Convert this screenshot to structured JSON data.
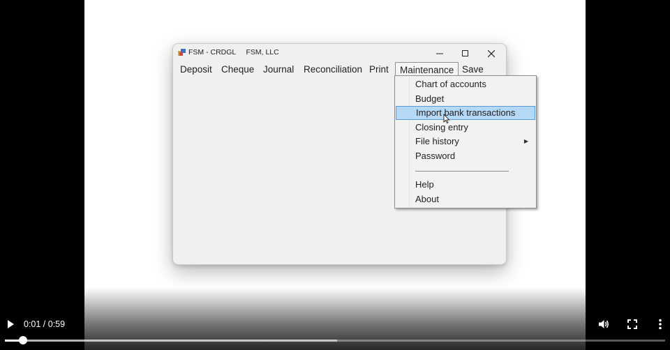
{
  "app": {
    "title": "FSM - CRDGL",
    "company": "FSM, LLC",
    "window_controls": {
      "minimize_icon": "minimize-icon",
      "maximize_icon": "maximize-icon",
      "close_icon": "close-icon"
    }
  },
  "menubar": {
    "items": [
      "Deposit",
      "Cheque",
      "Journal",
      "Reconciliation",
      "Print",
      "Maintenance",
      "Save"
    ],
    "open_item": "Maintenance"
  },
  "maintenance_menu": {
    "items": [
      {
        "label": "Chart of accounts"
      },
      {
        "label": "Budget"
      },
      {
        "label": "Import bank transactions",
        "highlighted": true
      },
      {
        "label": "Closing entry"
      },
      {
        "label": "File history",
        "submenu": true
      },
      {
        "label": "Password"
      },
      {
        "label": "Help"
      },
      {
        "label": "About"
      }
    ]
  },
  "player": {
    "time": "0:01 / 0:59",
    "progress_fraction": 0.028,
    "buffered_fraction": 0.503,
    "icons": [
      "play-icon",
      "volume-icon",
      "fullscreen-icon",
      "more-options-icon"
    ]
  },
  "colors": {
    "highlight_bg": "#b5d8f7",
    "highlight_border": "#5a9bd8",
    "window_bg": "#f0f0f0"
  }
}
